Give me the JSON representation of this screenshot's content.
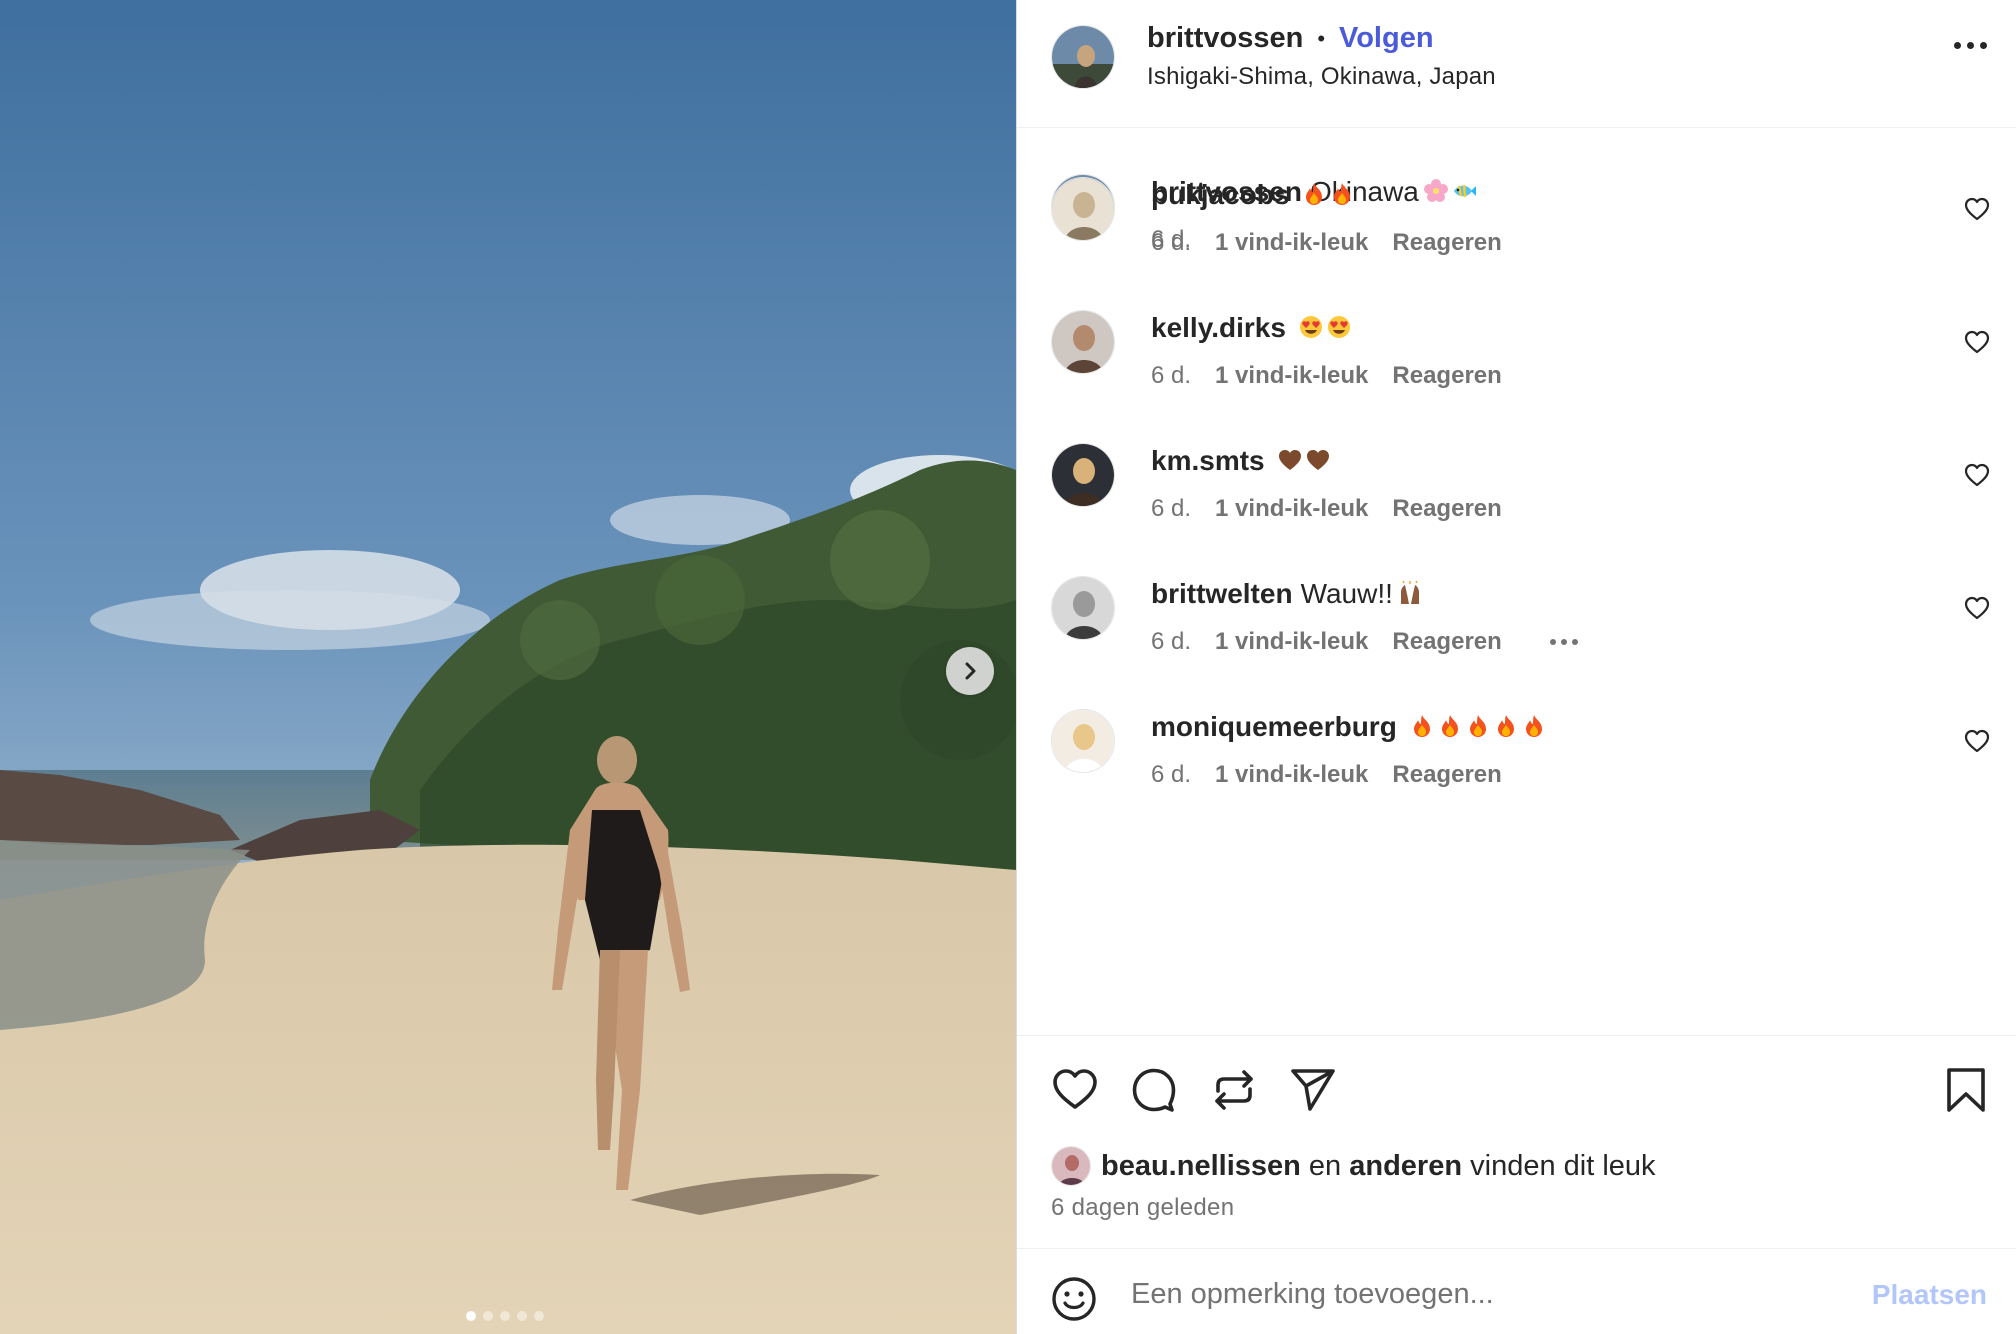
{
  "post": {
    "username": "brittvossen",
    "follow_label": "Volgen",
    "location": "Ishigaki-Shima, Okinawa, Japan",
    "more_icon": "more-horizontal-icon",
    "carousel": {
      "slide_count": 5,
      "active_index": 0,
      "next_icon": "chevron-right-icon"
    }
  },
  "caption": {
    "username": "brittvossen",
    "text": "Okinawa",
    "emojis": [
      "cherry-blossom",
      "tropical-fish"
    ],
    "time": "6 d."
  },
  "comments": [
    {
      "username": "pukjacobs",
      "text": "",
      "emojis": [
        "fire",
        "fire"
      ],
      "time": "6 d.",
      "likes": "1 vind-ik-leuk",
      "reply": "Reageren",
      "show_more": false
    },
    {
      "username": "kelly.dirks",
      "text": "",
      "emojis": [
        "heart-eyes",
        "heart-eyes"
      ],
      "time": "6 d.",
      "likes": "1 vind-ik-leuk",
      "reply": "Reageren",
      "show_more": false
    },
    {
      "username": "km.smts",
      "text": "",
      "emojis": [
        "brown-heart",
        "brown-heart"
      ],
      "time": "6 d.",
      "likes": "1 vind-ik-leuk",
      "reply": "Reageren",
      "show_more": false
    },
    {
      "username": "brittwelten",
      "text": "Wauw!!",
      "emojis": [
        "raising-hands"
      ],
      "time": "6 d.",
      "likes": "1 vind-ik-leuk",
      "reply": "Reageren",
      "show_more": true
    },
    {
      "username": "moniquemeerburg",
      "text": "",
      "emojis": [
        "fire",
        "fire",
        "fire",
        "fire",
        "fire"
      ],
      "time": "6 d.",
      "likes": "1 vind-ik-leuk",
      "reply": "Reageren",
      "show_more": false
    }
  ],
  "actions": {
    "icons": [
      "heart-icon",
      "comment-icon",
      "repost-icon",
      "share-icon",
      "bookmark-icon"
    ]
  },
  "likes": {
    "first_user": "beau.nellissen",
    "connector": "en",
    "others": "anderen",
    "suffix": "vinden dit leuk"
  },
  "date": "6 dagen geleden",
  "add_comment": {
    "placeholder": "Een opmerking toevoegen...",
    "post_label": "Plaatsen",
    "emoji_icon": "smiley-icon"
  },
  "colors": {
    "follow": "#4a5ad8",
    "post_button_disabled": "#b2c6f8",
    "text_primary": "#262626",
    "text_secondary": "#737373"
  }
}
